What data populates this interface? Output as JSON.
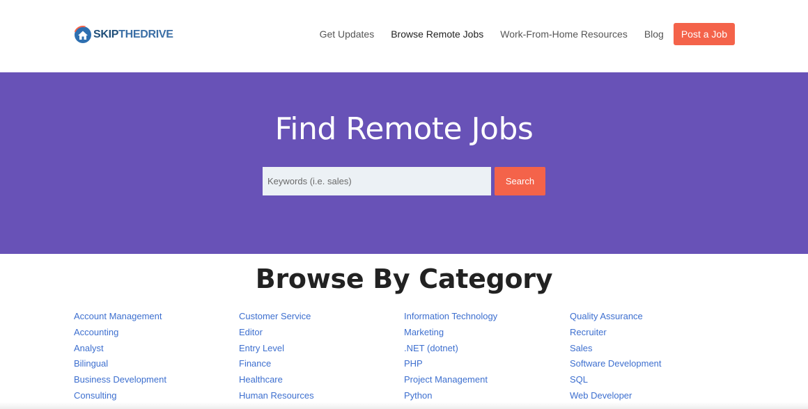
{
  "brand": {
    "part1": "SKIP",
    "part2": "THEDRIVE",
    "logo_icon": "house-arrow-logo-icon"
  },
  "nav": {
    "items": [
      {
        "label": "Get Updates"
      },
      {
        "label": "Browse Remote Jobs"
      },
      {
        "label": "Work-From-Home Resources"
      },
      {
        "label": "Blog"
      }
    ],
    "post_job_label": "Post a Job"
  },
  "hero": {
    "title": "Find Remote Jobs",
    "search_placeholder": "Keywords (i.e. sales)",
    "search_value": "",
    "search_button": "Search"
  },
  "categories": {
    "title": "Browse By Category",
    "columns": [
      [
        "Account Management",
        "Accounting",
        "Analyst",
        "Bilingual",
        "Business Development",
        "Consulting"
      ],
      [
        "Customer Service",
        "Editor",
        "Entry Level",
        "Finance",
        "Healthcare",
        "Human Resources"
      ],
      [
        "Information Technology",
        "Marketing",
        ".NET (dotnet)",
        "PHP",
        "Project Management",
        "Python"
      ],
      [
        "Quality Assurance",
        "Recruiter",
        "Sales",
        "Software Development",
        "SQL",
        "Web Developer"
      ]
    ]
  },
  "colors": {
    "hero_bg": "#6852b7",
    "accent": "#f4634a",
    "link": "#3d6fcf",
    "logo_dark": "#1f4e79"
  }
}
